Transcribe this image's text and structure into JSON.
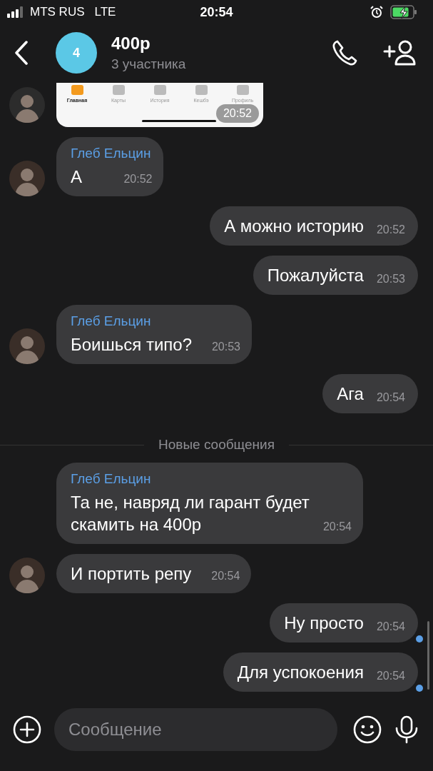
{
  "status_bar": {
    "carrier": "MTS RUS",
    "network": "LTE",
    "time": "20:54"
  },
  "header": {
    "avatar_text": "4",
    "title": "400р",
    "subtitle": "3 участника"
  },
  "messages": [
    {
      "kind": "image",
      "avatar": true,
      "tabs": [
        {
          "label": "Главная",
          "selected": true
        },
        {
          "label": "Карты",
          "selected": false
        },
        {
          "label": "История",
          "selected": false
        },
        {
          "label": "Кешбэ",
          "selected": false
        },
        {
          "label": "Профиль",
          "selected": false
        }
      ],
      "time": "20:52"
    },
    {
      "kind": "incoming",
      "sender": "Глеб Ельцин",
      "avatar": true,
      "text": "А",
      "time": "20:52"
    },
    {
      "kind": "outgoing",
      "text": "А можно историю",
      "time": "20:52",
      "unread": false
    },
    {
      "kind": "outgoing",
      "text": "Пожалуйста",
      "time": "20:53",
      "unread": false
    },
    {
      "kind": "incoming",
      "sender": "Глеб Ельцин",
      "avatar": true,
      "text": "Боишься типо?",
      "time": "20:53"
    },
    {
      "kind": "outgoing",
      "text": "Ага",
      "time": "20:54",
      "unread": false
    },
    {
      "kind": "divider",
      "text": "Новые сообщения"
    },
    {
      "kind": "incoming",
      "sender": "Глеб Ельцин",
      "avatar": false,
      "text": "Та не, навряд ли гарант будет скамить на 400р",
      "time": "20:54"
    },
    {
      "kind": "incoming",
      "avatar": true,
      "text": "И портить репу",
      "time": "20:54"
    },
    {
      "kind": "outgoing",
      "text": "Ну просто",
      "time": "20:54",
      "unread": true
    },
    {
      "kind": "outgoing",
      "text": "Для успокоения",
      "time": "20:54",
      "unread": true
    }
  ],
  "composer": {
    "placeholder": "Сообщение"
  }
}
